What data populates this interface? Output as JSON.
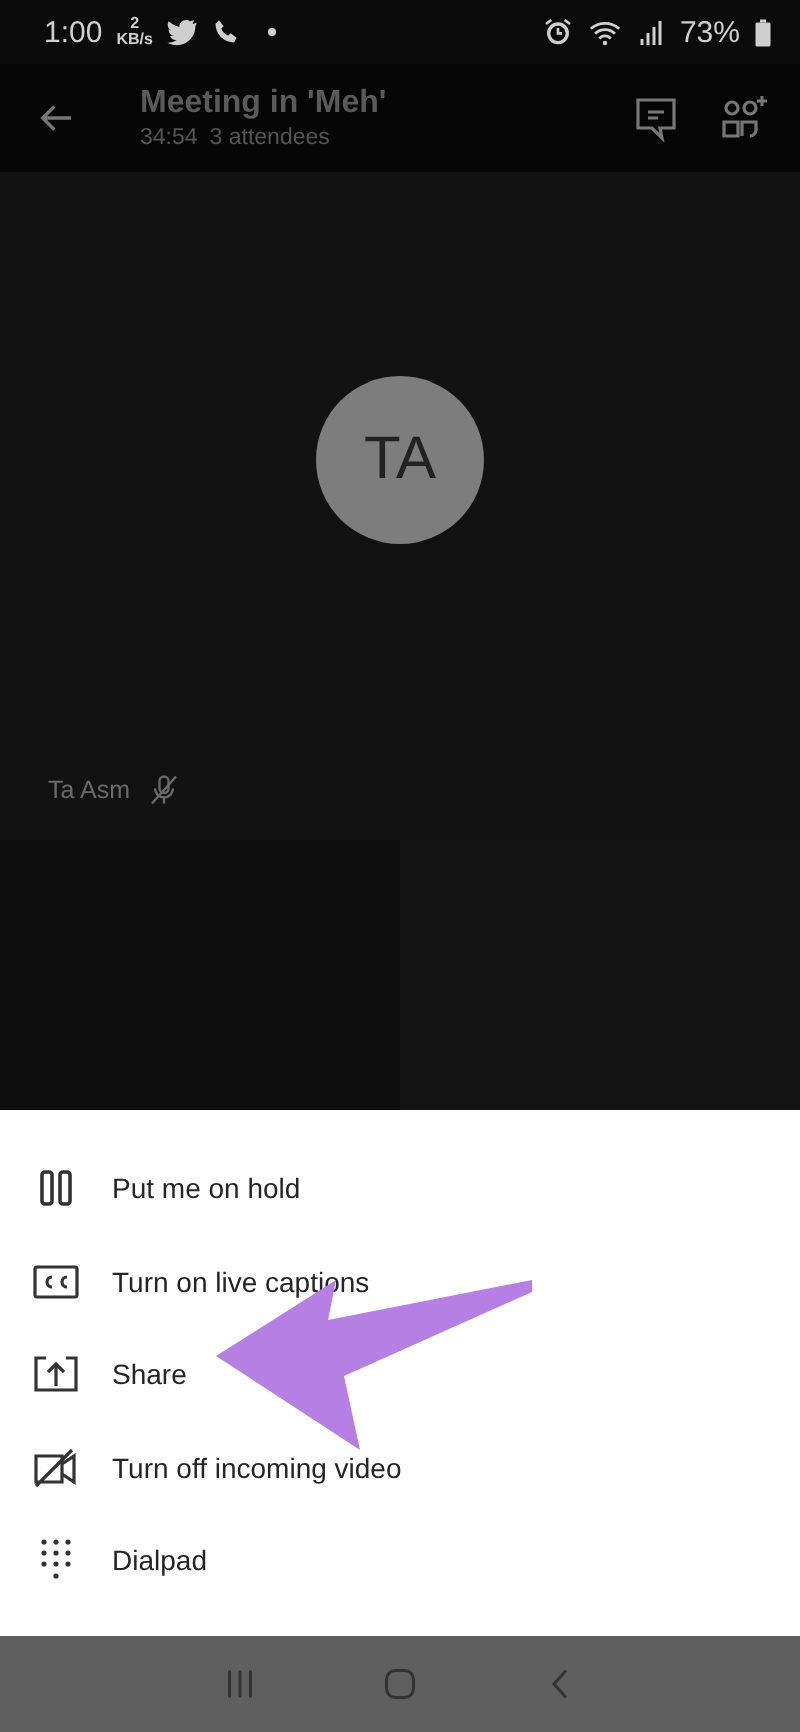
{
  "status_bar": {
    "time": "1:00",
    "speed_value": "2",
    "speed_unit": "KB/s",
    "battery": "73%"
  },
  "header": {
    "title": "Meeting in 'Meh'",
    "duration": "34:54",
    "attendees": "3 attendees"
  },
  "participant": {
    "initials": "TA",
    "name": "Ta Asm",
    "muted": true
  },
  "menu": [
    {
      "kind": "hold",
      "label": "Put me on hold"
    },
    {
      "kind": "captions",
      "label": "Turn on live captions"
    },
    {
      "kind": "share",
      "label": "Share"
    },
    {
      "kind": "video-off",
      "label": "Turn off incoming video"
    },
    {
      "kind": "dialpad",
      "label": "Dialpad"
    }
  ],
  "annotations": [
    {
      "kind": "arrow",
      "color": "#b57fe3"
    }
  ]
}
